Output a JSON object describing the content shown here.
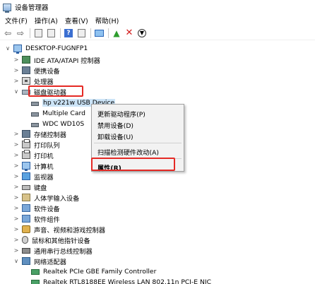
{
  "window": {
    "title": "设备管理器"
  },
  "menu": [
    "文件(F)",
    "操作(A)",
    "查看(V)",
    "帮助(H)"
  ],
  "toolbar": {
    "back_icon": "back-arrow-icon",
    "forward_icon": "forward-arrow-icon",
    "help_label": "?"
  },
  "tree": {
    "root": "DESKTOP-FUGNFP1",
    "ide": "IDE ATA/ATAPI 控制器",
    "portable": "便携设备",
    "cpu": "处理器",
    "disk": "磁盘驱动器",
    "disk_children": [
      "hp v221w USB Device",
      "Multiple Card",
      "WDC WD10S"
    ],
    "storage": "存储控制器",
    "print_queue": "打印队列",
    "printer": "打印机",
    "computer": "计算机",
    "monitor": "监视器",
    "keyboard": "键盘",
    "hid": "人体学输入设备",
    "software_device": "软件设备",
    "software_component": "软件组件",
    "sound": "声音、视频和游戏控制器",
    "mouse": "鼠标和其他指针设备",
    "usb": "通用串行总线控制器",
    "network": "网络适配器",
    "network_children": [
      "Realtek PCIe GBE Family Controller",
      "Realtek RTL8188EE Wireless LAN 802.11n PCI-E NIC"
    ]
  },
  "context_menu": {
    "update_driver": "更新驱动程序(P)",
    "disable_device": "禁用设备(D)",
    "uninstall_device": "卸载设备(U)",
    "scan_changes": "扫描检测硬件改动(A)",
    "properties": "属性(R)"
  },
  "colors": {
    "highlight": "#e52a25",
    "selection": "#cce4f7"
  }
}
